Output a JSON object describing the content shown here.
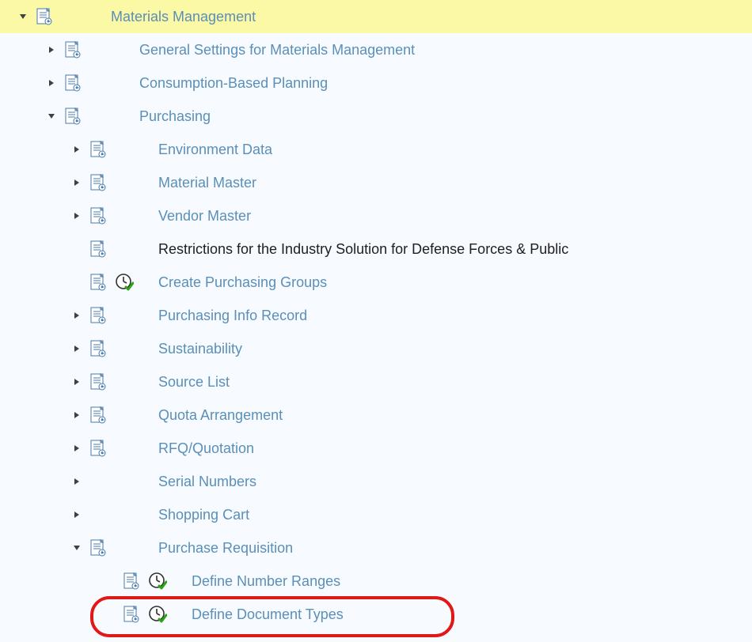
{
  "tree": {
    "materials_management": "Materials Management",
    "general_settings": "General Settings for Materials Management",
    "consumption_based": "Consumption-Based Planning",
    "purchasing": "Purchasing",
    "environment_data": "Environment Data",
    "material_master": "Material Master",
    "vendor_master": "Vendor Master",
    "restrictions": "Restrictions for the Industry Solution for Defense Forces & Public",
    "create_purch_groups": "Create Purchasing Groups",
    "purch_info_record": "Purchasing Info Record",
    "sustainability": "Sustainability",
    "source_list": "Source List",
    "quota_arrangement": "Quota Arrangement",
    "rfq_quotation": "RFQ/Quotation",
    "serial_numbers": "Serial Numbers",
    "shopping_cart": "Shopping Cart",
    "purchase_requisition": "Purchase Requisition",
    "define_number_ranges": "Define Number Ranges",
    "define_document_types": "Define Document Types"
  }
}
